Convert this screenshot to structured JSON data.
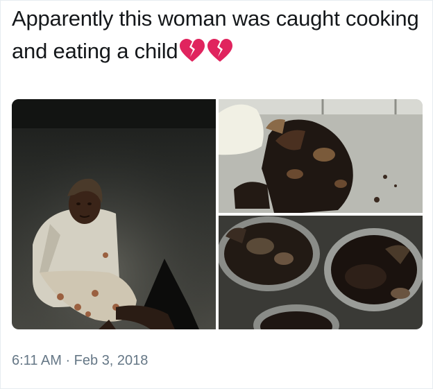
{
  "tweet": {
    "text": "Apparently this woman was caught cooking and eating a child",
    "emoji": [
      "broken-heart-icon",
      "broken-heart-icon"
    ],
    "timestamp": "6:11 AM · Feb 3, 2018"
  },
  "media": {
    "photos": [
      "woman-sitting-on-ground-photo",
      "charred-meat-photo",
      "cooking-pots-photo"
    ]
  },
  "colors": {
    "text": "#14171a",
    "muted": "#657786",
    "heart": "#e0245e"
  }
}
